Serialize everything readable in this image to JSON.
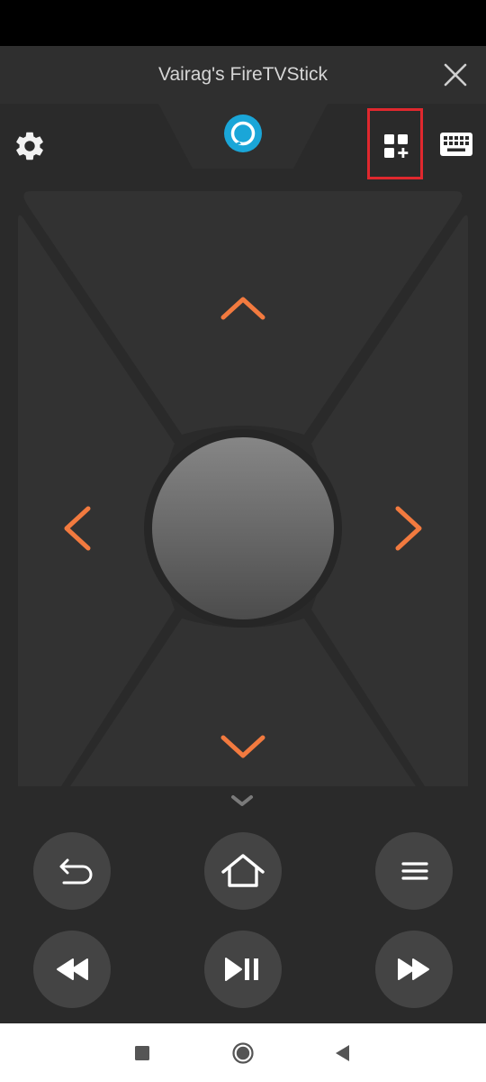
{
  "header": {
    "title": "Vairag's FireTVStick",
    "close_icon": "close-icon"
  },
  "toolbar": {
    "settings_icon": "gear-icon",
    "alexa_icon": "alexa-icon",
    "apps_icon": "apps-add-icon",
    "keyboard_icon": "keyboard-icon",
    "highlight_color": "#e0282e"
  },
  "dpad": {
    "up_icon": "chevron-up-icon",
    "down_icon": "chevron-down-icon",
    "left_icon": "chevron-left-icon",
    "right_icon": "chevron-right-icon",
    "select": "select-button",
    "accent_color": "#f27a3f"
  },
  "controls": {
    "row1": [
      "back-icon",
      "home-icon",
      "menu-icon"
    ],
    "row2": [
      "rewind-icon",
      "play-pause-icon",
      "fast-forward-icon"
    ]
  },
  "system_nav": [
    "recents-icon",
    "home-circle-icon",
    "back-triangle-icon"
  ],
  "colors": {
    "background": "#2a2a2a",
    "header": "#2f2f2f",
    "button": "#444444",
    "alexa": "#1aa6d8"
  }
}
